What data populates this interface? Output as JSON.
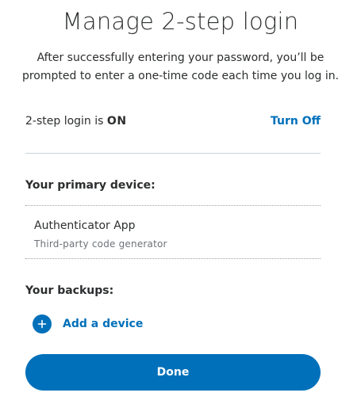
{
  "header": {
    "title": "Manage 2-step login",
    "description_line1": "After successfully entering your password, you’ll be",
    "description_line2": "prompted to enter a one-time code each time you log in."
  },
  "status": {
    "label": "2-step login is ",
    "value": "ON",
    "action_label": "Turn Off"
  },
  "primary_device": {
    "heading": "Your primary device:",
    "name": "Authenticator App",
    "description": "Third-party code generator"
  },
  "backups": {
    "heading": "Your backups:",
    "add_label": "Add a device"
  },
  "footer": {
    "done_label": "Done"
  },
  "colors": {
    "accent": "#0070ba",
    "text": "#2c2e2f",
    "muted": "#6c7378"
  },
  "icons": {
    "add": "plus-icon"
  }
}
